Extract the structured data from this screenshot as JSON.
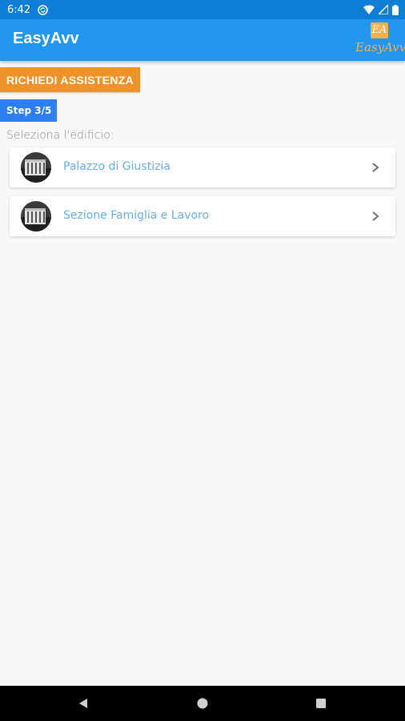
{
  "status_bar": {
    "time": "6:42",
    "icons": [
      "sync-icon",
      "wifi-icon",
      "signal-icon",
      "battery-icon"
    ]
  },
  "app_bar": {
    "title": "EasyAvv",
    "logo_monogram": "EA",
    "logo_text": "EasyAvv",
    "color": "#2196f3"
  },
  "assist_button": {
    "label": "RICHIEDI ASSISTENZA",
    "color": "#f0922a"
  },
  "step": {
    "label": "Step 3/5",
    "color": "#2d7ff0"
  },
  "section_label": "Seleziona l'edificio:",
  "buildings": [
    {
      "name": "Palazzo di Giustizia",
      "icon": "building-photo-icon"
    },
    {
      "name": "Sezione Famiglia e Lavoro",
      "icon": "building-photo-icon"
    }
  ],
  "nav_bar": {
    "icons": [
      "back-icon",
      "home-icon",
      "recents-icon"
    ]
  }
}
